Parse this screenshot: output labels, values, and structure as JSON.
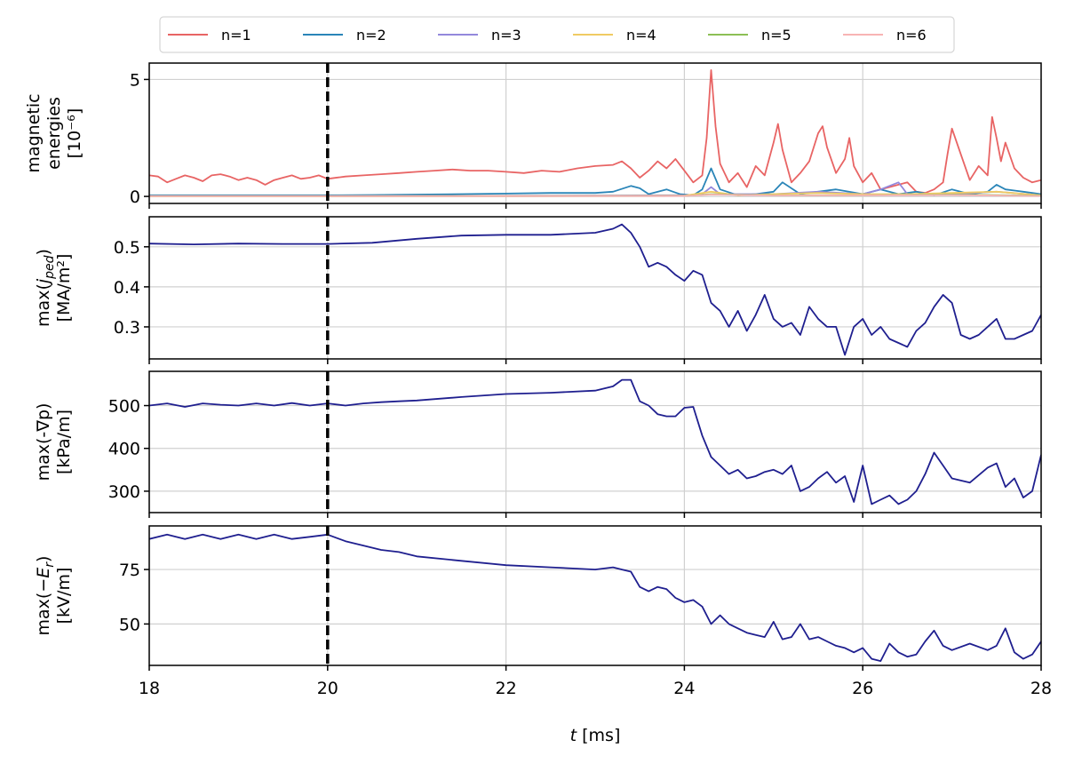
{
  "chart_data": {
    "type": "line",
    "shared_x": {
      "xlim": [
        18,
        28
      ],
      "xticks": [
        18,
        20,
        22,
        24,
        26,
        28
      ],
      "xlabel": "t [ms]",
      "vline_x": 20,
      "vline_color": "#000000"
    },
    "legend": {
      "placement": "top-center",
      "entries": [
        {
          "name": "n=1",
          "color": "#e86464"
        },
        {
          "name": "n=2",
          "color": "#2a85b8"
        },
        {
          "name": "n=3",
          "color": "#9388dc"
        },
        {
          "name": "n=4",
          "color": "#f0cb63"
        },
        {
          "name": "n=5",
          "color": "#8cbf55"
        },
        {
          "name": "n=6",
          "color": "#f8b4b4"
        }
      ]
    },
    "panels": [
      {
        "id": "magnetic",
        "ylabel_lines": [
          "magnetic",
          "energies",
          "[10⁻⁶]"
        ],
        "ylim": [
          -0.3,
          5.7
        ],
        "yticks": [
          0,
          5
        ],
        "ytick_labels": [
          "0",
          "5"
        ],
        "grid": true,
        "series": [
          {
            "name": "n=1",
            "color": "#e86464",
            "x": [
              18.0,
              18.1,
              18.2,
              18.3,
              18.4,
              18.5,
              18.6,
              18.7,
              18.8,
              18.9,
              19.0,
              19.1,
              19.2,
              19.3,
              19.4,
              19.5,
              19.6,
              19.7,
              19.8,
              19.9,
              20.0,
              20.2,
              20.4,
              20.6,
              20.8,
              21.0,
              21.2,
              21.4,
              21.6,
              21.8,
              22.0,
              22.2,
              22.4,
              22.6,
              22.8,
              23.0,
              23.2,
              23.3,
              23.4,
              23.5,
              23.6,
              23.7,
              23.8,
              23.9,
              24.0,
              24.1,
              24.2,
              24.25,
              24.3,
              24.35,
              24.4,
              24.5,
              24.6,
              24.7,
              24.8,
              24.9,
              25.0,
              25.05,
              25.1,
              25.2,
              25.3,
              25.4,
              25.5,
              25.55,
              25.6,
              25.7,
              25.8,
              25.85,
              25.9,
              26.0,
              26.1,
              26.2,
              26.3,
              26.4,
              26.5,
              26.6,
              26.7,
              26.8,
              26.9,
              26.95,
              27.0,
              27.1,
              27.2,
              27.3,
              27.4,
              27.45,
              27.5,
              27.55,
              27.6,
              27.7,
              27.8,
              27.9,
              28.0
            ],
            "y": [
              0.9,
              0.85,
              0.6,
              0.75,
              0.9,
              0.8,
              0.65,
              0.9,
              0.95,
              0.85,
              0.7,
              0.8,
              0.7,
              0.5,
              0.7,
              0.8,
              0.9,
              0.75,
              0.8,
              0.9,
              0.75,
              0.85,
              0.9,
              0.95,
              1.0,
              1.05,
              1.1,
              1.15,
              1.1,
              1.1,
              1.05,
              1.0,
              1.1,
              1.05,
              1.2,
              1.3,
              1.35,
              1.5,
              1.2,
              0.8,
              1.1,
              1.5,
              1.2,
              1.6,
              1.1,
              0.6,
              0.9,
              2.5,
              5.4,
              3.0,
              1.4,
              0.6,
              1.0,
              0.4,
              1.3,
              0.9,
              2.3,
              3.1,
              2.0,
              0.6,
              1.0,
              1.5,
              2.7,
              3.0,
              2.1,
              1.0,
              1.6,
              2.5,
              1.3,
              0.6,
              1.0,
              0.3,
              0.4,
              0.5,
              0.6,
              0.2,
              0.15,
              0.3,
              0.6,
              1.8,
              2.9,
              1.8,
              0.7,
              1.3,
              0.9,
              3.4,
              2.5,
              1.5,
              2.3,
              1.2,
              0.8,
              0.6,
              0.7
            ]
          },
          {
            "name": "n=2",
            "color": "#2a85b8",
            "x": [
              18.0,
              19.0,
              20.0,
              20.5,
              21.0,
              21.5,
              22.0,
              22.5,
              23.0,
              23.2,
              23.4,
              23.5,
              23.6,
              23.8,
              23.95,
              24.1,
              24.2,
              24.3,
              24.4,
              24.6,
              24.8,
              25.0,
              25.1,
              25.3,
              25.5,
              25.7,
              26.0,
              26.2,
              26.4,
              26.6,
              26.8,
              27.0,
              27.2,
              27.4,
              27.5,
              27.6,
              27.8,
              28.0
            ],
            "y": [
              0.05,
              0.05,
              0.05,
              0.06,
              0.08,
              0.1,
              0.12,
              0.15,
              0.15,
              0.2,
              0.45,
              0.35,
              0.1,
              0.3,
              0.1,
              0.05,
              0.3,
              1.2,
              0.3,
              0.05,
              0.1,
              0.2,
              0.6,
              0.1,
              0.2,
              0.3,
              0.1,
              0.3,
              0.1,
              0.2,
              0.05,
              0.3,
              0.1,
              0.2,
              0.5,
              0.3,
              0.2,
              0.1
            ]
          },
          {
            "name": "n=3",
            "color": "#9388dc",
            "x": [
              18.0,
              20.0,
              22.0,
              24.0,
              24.2,
              24.3,
              24.4,
              25.0,
              25.5,
              26.0,
              26.2,
              26.4,
              26.5,
              27.0,
              27.5,
              28.0
            ],
            "y": [
              0.02,
              0.02,
              0.03,
              0.05,
              0.1,
              0.4,
              0.1,
              0.1,
              0.2,
              0.1,
              0.3,
              0.6,
              0.1,
              0.1,
              0.2,
              0.05
            ]
          },
          {
            "name": "n=4",
            "color": "#f0cb63",
            "x": [
              18.0,
              20.0,
              22.0,
              24.0,
              24.3,
              24.6,
              25.0,
              25.5,
              26.0,
              26.5,
              27.0,
              27.5,
              28.0
            ],
            "y": [
              0.01,
              0.01,
              0.02,
              0.03,
              0.2,
              0.05,
              0.1,
              0.15,
              0.1,
              0.1,
              0.15,
              0.2,
              0.05
            ]
          },
          {
            "name": "n=5",
            "color": "#8cbf55",
            "x": [
              18.0,
              20.0,
              22.0,
              24.0,
              24.3,
              25.0,
              26.0,
              27.0,
              28.0
            ],
            "y": [
              0.01,
              0.01,
              0.01,
              0.02,
              0.1,
              0.05,
              0.05,
              0.08,
              0.03
            ]
          },
          {
            "name": "n=6",
            "color": "#f8b4b4",
            "x": [
              18.0,
              20.0,
              22.0,
              24.0,
              24.3,
              25.0,
              26.0,
              27.0,
              28.0
            ],
            "y": [
              0.01,
              0.01,
              0.01,
              0.02,
              0.08,
              0.04,
              0.05,
              0.06,
              0.02
            ]
          }
        ]
      },
      {
        "id": "jped",
        "ylabel_lines": [
          "max(j_ped)",
          "[MA/m²]"
        ],
        "ylim": [
          0.22,
          0.575
        ],
        "yticks": [
          0.3,
          0.4,
          0.5
        ],
        "ytick_labels": [
          "0.3",
          "0.4",
          "0.5"
        ],
        "grid": true,
        "series": [
          {
            "name": "",
            "color": "#1f1f8f",
            "x": [
              18.0,
              18.5,
              19.0,
              19.5,
              20.0,
              20.5,
              21.0,
              21.5,
              22.0,
              22.5,
              23.0,
              23.2,
              23.3,
              23.4,
              23.5,
              23.6,
              23.7,
              23.8,
              23.9,
              24.0,
              24.1,
              24.2,
              24.3,
              24.4,
              24.5,
              24.6,
              24.7,
              24.8,
              24.9,
              25.0,
              25.1,
              25.2,
              25.3,
              25.4,
              25.5,
              25.6,
              25.7,
              25.8,
              25.9,
              26.0,
              26.1,
              26.2,
              26.3,
              26.4,
              26.5,
              26.6,
              26.7,
              26.8,
              26.9,
              27.0,
              27.1,
              27.2,
              27.3,
              27.4,
              27.5,
              27.6,
              27.7,
              27.8,
              27.9,
              28.0
            ],
            "y": [
              0.508,
              0.506,
              0.508,
              0.507,
              0.507,
              0.51,
              0.52,
              0.528,
              0.53,
              0.53,
              0.535,
              0.545,
              0.556,
              0.535,
              0.5,
              0.45,
              0.46,
              0.45,
              0.43,
              0.415,
              0.44,
              0.43,
              0.36,
              0.34,
              0.3,
              0.34,
              0.29,
              0.33,
              0.38,
              0.32,
              0.3,
              0.31,
              0.28,
              0.35,
              0.32,
              0.3,
              0.3,
              0.23,
              0.3,
              0.32,
              0.28,
              0.3,
              0.27,
              0.26,
              0.25,
              0.29,
              0.31,
              0.35,
              0.38,
              0.36,
              0.28,
              0.27,
              0.28,
              0.3,
              0.32,
              0.27,
              0.27,
              0.28,
              0.29,
              0.33
            ]
          }
        ]
      },
      {
        "id": "gradp",
        "ylabel_lines": [
          "max(-∇p)",
          "[kPa/m]"
        ],
        "ylim": [
          250,
          580
        ],
        "yticks": [
          300,
          400,
          500
        ],
        "ytick_labels": [
          "300",
          "400",
          "500"
        ],
        "grid": true,
        "series": [
          {
            "name": "",
            "color": "#1f1f8f",
            "x": [
              18.0,
              18.2,
              18.4,
              18.6,
              18.8,
              19.0,
              19.2,
              19.4,
              19.6,
              19.8,
              20.0,
              20.2,
              20.4,
              20.6,
              20.8,
              21.0,
              21.5,
              22.0,
              22.5,
              23.0,
              23.2,
              23.3,
              23.4,
              23.5,
              23.6,
              23.7,
              23.8,
              23.9,
              24.0,
              24.1,
              24.2,
              24.3,
              24.4,
              24.5,
              24.6,
              24.7,
              24.8,
              24.9,
              25.0,
              25.1,
              25.2,
              25.3,
              25.4,
              25.5,
              25.6,
              25.7,
              25.8,
              25.9,
              26.0,
              26.1,
              26.2,
              26.3,
              26.4,
              26.5,
              26.6,
              26.7,
              26.8,
              26.9,
              27.0,
              27.2,
              27.4,
              27.5,
              27.6,
              27.7,
              27.8,
              27.9,
              28.0
            ],
            "y": [
              500,
              505,
              497,
              505,
              502,
              500,
              505,
              500,
              506,
              500,
              505,
              500,
              505,
              508,
              510,
              512,
              520,
              527,
              530,
              535,
              545,
              560,
              560,
              510,
              500,
              480,
              475,
              475,
              495,
              497,
              430,
              380,
              360,
              340,
              350,
              330,
              335,
              345,
              350,
              340,
              360,
              300,
              310,
              330,
              345,
              320,
              335,
              275,
              360,
              270,
              280,
              290,
              270,
              280,
              300,
              340,
              390,
              360,
              330,
              320,
              355,
              365,
              310,
              330,
              285,
              300,
              385
            ]
          }
        ]
      },
      {
        "id": "er",
        "ylabel_lines": [
          "max(−E_r)",
          "[kV/m]"
        ],
        "ylim": [
          31,
          95
        ],
        "yticks": [
          50,
          75
        ],
        "ytick_labels": [
          "50",
          "75"
        ],
        "grid": true,
        "series": [
          {
            "name": "",
            "color": "#1f1f8f",
            "x": [
              18.0,
              18.2,
              18.4,
              18.6,
              18.8,
              19.0,
              19.2,
              19.4,
              19.6,
              19.8,
              20.0,
              20.2,
              20.4,
              20.6,
              20.8,
              21.0,
              21.5,
              22.0,
              22.5,
              23.0,
              23.2,
              23.3,
              23.4,
              23.5,
              23.6,
              23.7,
              23.8,
              23.9,
              24.0,
              24.1,
              24.2,
              24.3,
              24.4,
              24.5,
              24.6,
              24.7,
              24.8,
              24.9,
              25.0,
              25.1,
              25.2,
              25.3,
              25.4,
              25.5,
              25.6,
              25.7,
              25.8,
              25.9,
              26.0,
              26.1,
              26.2,
              26.3,
              26.4,
              26.5,
              26.6,
              26.7,
              26.8,
              26.9,
              27.0,
              27.2,
              27.4,
              27.5,
              27.6,
              27.7,
              27.8,
              27.9,
              28.0
            ],
            "y": [
              89,
              91,
              89,
              91,
              89,
              91,
              89,
              91,
              89,
              90,
              91,
              88,
              86,
              84,
              83,
              81,
              79,
              77,
              76,
              75,
              76,
              75,
              74,
              67,
              65,
              67,
              66,
              62,
              60,
              61,
              58,
              50,
              54,
              50,
              48,
              46,
              45,
              44,
              51,
              43,
              44,
              50,
              43,
              44,
              42,
              40,
              39,
              37,
              39,
              34,
              33,
              41,
              37,
              35,
              36,
              42,
              47,
              40,
              38,
              41,
              38,
              40,
              48,
              37,
              34,
              36,
              42
            ]
          }
        ]
      }
    ]
  }
}
